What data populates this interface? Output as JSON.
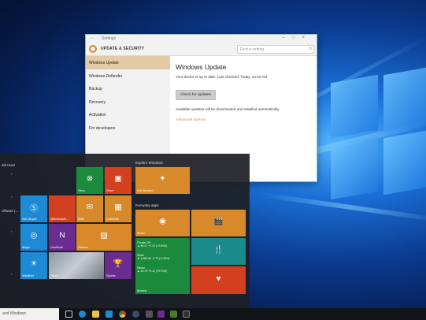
{
  "settings": {
    "window_title": "Settings",
    "header_title": "UPDATE & SECURITY",
    "search_placeholder": "Find a setting",
    "nav": [
      "Windows Update",
      "Windows Defender",
      "Backup",
      "Recovery",
      "Activation",
      "For developers"
    ],
    "content": {
      "heading": "Windows Update",
      "status": "Your device is up to date. Last checked: Today, 10:42 AM",
      "check_button": "Check for updates",
      "available_text": "Available updates will be downloaded and installed automatically.",
      "advanced_link": "Advanced options"
    }
  },
  "start": {
    "left_labels": [
      "ald Hunt",
      "oftware (...",
      ""
    ],
    "explore_header": "Explore Windows",
    "everyday_header": "Everyday apps",
    "tiles": {
      "xbox": "Xbox",
      "store": "Store",
      "get_started": "Get Started",
      "get_skype": "Get Skype",
      "shmerss": "@hmersoft...",
      "mail": "Mail",
      "calendar": "Calendar",
      "maps": "Maps",
      "onenote": "OneNote",
      "photos": "Photos",
      "weather": "Weather",
      "news": "News",
      "sports": "Sports",
      "music": "Music",
      "money": "Money",
      "crude_oil": "Crude Oil",
      "crude_oil_val": "▲ 48.21 +1.22 (+2.60%)",
      "gold": "Gold",
      "gold_val": "▼ 1,080.50 -2.70 (-0.25%)",
      "silver": "Silver",
      "silver_val": "▲ 14.75 +0.11 (+0.74%)"
    }
  },
  "taskbar": {
    "search_text": "and Windows"
  },
  "colors": {
    "accent_orange": "#d88a2a",
    "tile_blue": "#1e8ad6",
    "tile_green": "#1c8a3c",
    "tile_purple": "#6a2c91",
    "tile_red": "#d3401f"
  }
}
